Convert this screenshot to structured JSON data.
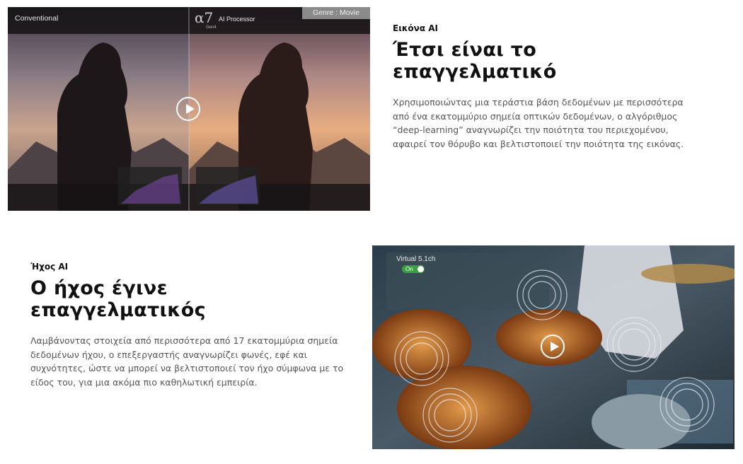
{
  "section_picture": {
    "eyebrow": "Εικόνα AI",
    "headline": "Έτσι είναι το επαγγελματικό",
    "body": "Χρησιμοποιώντας μια τεράστια βάση δεδομένων με περισσότερα από ένα εκατομμύριο σημεία οπτικών δεδομένων, ο αλγόριθμος “deep-learning” αναγνωρίζει την ποιότητα του περιεχομένου, αφαιρεί τον θόρυβο και βελτιστοποιεί την ποιότητα της εικόνας.",
    "video": {
      "left_label": "Conventional",
      "logo_symbol": "α7",
      "logo_sub": "Gen4",
      "right_label": "AI Processor",
      "genre_badge": "Genre : Movie"
    }
  },
  "section_sound": {
    "eyebrow": "Ήχος AI",
    "headline": "Ο ήχος έγινε επαγγελματικός",
    "body": "Λαμβάνοντας στοιχεία από περισσότερα από 17 εκατομμύρια σημεία δεδομένων ήχου, ο επεξεργαστής αναγνωρίζει φωνές, εφέ και συχνότητες, ώστε να μπορεί να βελτιστοποιεί τον ήχο σύμφωνα με το είδος του, για μια ακόμα πιο καθηλωτική εμπειρία.",
    "video": {
      "mode_label": "Virtual 5.1ch",
      "toggle_label": "On"
    }
  },
  "colors": {
    "heading": "#111111",
    "body": "#555555",
    "toggle_on": "#3aa043"
  },
  "icons": [
    "play-icon"
  ]
}
